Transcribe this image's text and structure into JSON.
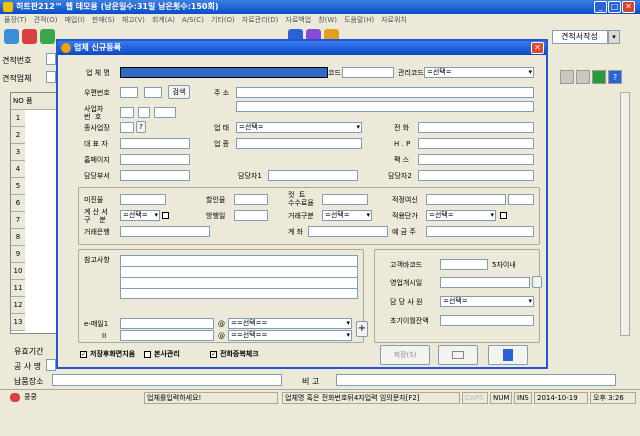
{
  "app": {
    "title": "히트판212™ 웹 데모용 (남은일수:31일 남은횟수:150회)",
    "menu": [
      "물장(T)",
      "견적(O)",
      "매입(I)",
      "판매(S)",
      "재고(V)",
      "회계(A)",
      "A/S(C)",
      "기타(O)",
      "자료관리(D)",
      "자료백업",
      "창(W)",
      "도움말(H)",
      "자료위치"
    ],
    "toolbar_right_label": "견적서작성",
    "bg_labels": {
      "quote_no": "견적번호",
      "quote_vendor": "견적업체",
      "col_no": "NO",
      "col_item": "품",
      "valid_period": "유효기간",
      "contractor": "공 사 명",
      "delivery_place": "납품장소",
      "remark": "비 고"
    },
    "grid_rows": [
      "1",
      "2",
      "3",
      "4",
      "5",
      "6",
      "7",
      "8",
      "9",
      "10",
      "11",
      "12",
      "13"
    ]
  },
  "dialog": {
    "title": "업체 신규등록",
    "close": "✕",
    "labels": {
      "vendor_name": "업 체 명",
      "code": "코드",
      "mgmt_code": "관리코드",
      "zip": "우편번호",
      "search": "검색",
      "address": "주 소",
      "biz_no": "사업자\n번  호",
      "sub_biz": "종사업장",
      "sub_biz_btn": "?",
      "business": "업 태",
      "phone": "전 화",
      "ceo": "대 표 자",
      "item": "업 종",
      "mobile": "H . P",
      "homepage": "홈페이지",
      "fax": "팩 스",
      "dept": "담당부서",
      "manager": "담당자1",
      "manager2": "담당자2",
      "unpaid": "미진율",
      "discount": "할인율",
      "cut_fee": "컷  트\n수수료율",
      "credit_limit": "적정여신",
      "settle": "계 산 서\n구    분",
      "pay_day": "방행일",
      "trade_type": "거래구분",
      "unit_price": "적용단가",
      "bank": "거래은행",
      "account": "계 좌",
      "depositor": "예 금 주",
      "notes": "참고사항",
      "email": "e-메일1",
      "email2": "II",
      "customer_code": "고객바코드",
      "limit_note": "5자이내",
      "biz_start": "영업개시일",
      "sales_rep": "담 당 사 원",
      "initial_balance": "초기이월잔액",
      "chk_keep_after_save": "저장후화면지움",
      "chk_hq": "본사관리",
      "chk_phone_dup": "전화중복체크",
      "save_btn": "저장(S)"
    },
    "values": {
      "mgmt_code": "=선택=",
      "business": "=선택=",
      "settle": "=선택=",
      "trade_type": "=선택=",
      "unit_price": "=선택=",
      "email_domain1": "==선택==",
      "email_domain2": "==선택==",
      "sales_rep": "=선택=",
      "at": "@"
    }
  },
  "status": {
    "user": "쿵쿵",
    "hint": "업체를입력하세요!",
    "shortcut": "업체명 혹은 전화번호뒤4자입력 임의문자[F2]",
    "caps": "CAPS",
    "num": "NUM",
    "ins": "INS",
    "date": "2014-10-19",
    "time": "오후 3:26"
  },
  "colors": {
    "titlebar": "#0a4cc8",
    "dialog_border": "#2456d0",
    "selected_field": "#316ac5",
    "close_red": "#e04a2a"
  }
}
